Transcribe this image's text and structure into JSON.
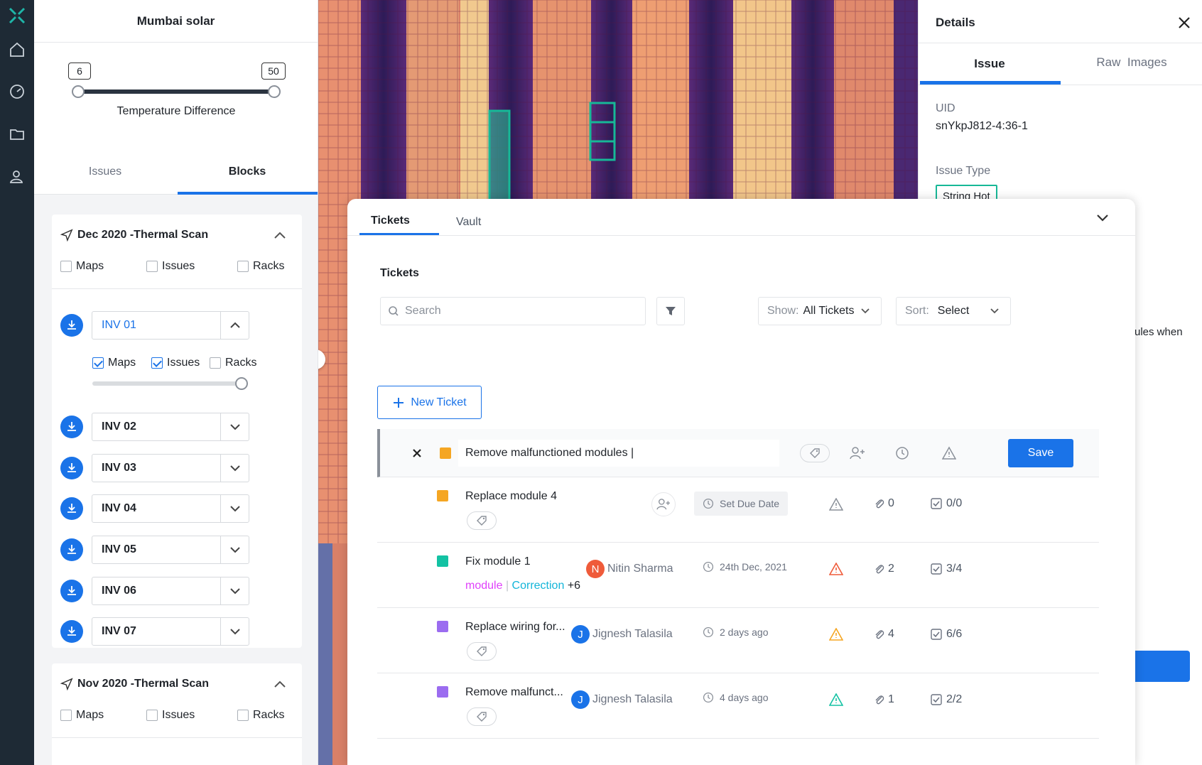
{
  "sidebar": {
    "title": "Mumbai solar",
    "slider": {
      "min_label": "6",
      "max_label": "50",
      "label": "Temperature Difference"
    },
    "tabs": [
      {
        "label": "Issues"
      },
      {
        "label": "Blocks"
      }
    ],
    "scans": [
      {
        "title": "Dec 2020 -Thermal Scan",
        "options": [
          "Maps",
          "Issues",
          "Racks"
        ]
      },
      {
        "title": "Nov 2020 -Thermal Scan",
        "options": [
          "Maps",
          "Issues",
          "Racks"
        ]
      }
    ],
    "inverters": [
      {
        "label": "INV 01",
        "expanded": true
      },
      {
        "label": "INV 02"
      },
      {
        "label": "INV 03"
      },
      {
        "label": "INV 04"
      },
      {
        "label": "INV 05"
      },
      {
        "label": "INV 06"
      },
      {
        "label": "INV 07"
      }
    ],
    "inv01_options": {
      "maps": "Maps",
      "issues": "Issues",
      "racks": "Racks",
      "maps_checked": true,
      "issues_checked": true,
      "racks_checked": false
    }
  },
  "details": {
    "title": "Details",
    "tabs": [
      {
        "label": "Issue"
      },
      {
        "label": "Raw  Images"
      }
    ],
    "uid_label": "UID",
    "uid_value": "snYkpJ812-4:36-1",
    "issue_type_label": "Issue Type",
    "issue_type_value": "String Hot",
    "partial_text": "ules when"
  },
  "tickets_panel": {
    "tabs": [
      {
        "label": "Tickets"
      },
      {
        "label": "Vault"
      }
    ],
    "heading": "Tickets",
    "search_placeholder": "Search",
    "show_label": "Show:",
    "show_value": "All Tickets",
    "sort_label": "Sort:",
    "sort_value": "Select",
    "new_ticket_label": "New Ticket",
    "editing": {
      "value": "Remove malfunctioned modules |",
      "save_label": "Save",
      "color": "#f5a623"
    },
    "tickets": [
      {
        "title": "Replace module 4",
        "color": "#f5a623",
        "assignee": "",
        "due": "Set Due Date",
        "attachments": "0",
        "checklist": "0/0",
        "priority_color": "#8a9099"
      },
      {
        "title": "Fix module 1",
        "color": "#13c2a3",
        "assignee": "Nitin Sharma",
        "avatar": "N",
        "avatar_color": "#ef5b3a",
        "due": "24th Dec, 2021",
        "attachments": "2",
        "checklist": "3/4",
        "priority_color": "#ef5b3a",
        "tags": [
          "module",
          "Correction"
        ],
        "more_tags": "+6"
      },
      {
        "title": "Replace wiring for...",
        "color": "#9b6cf0",
        "assignee": "Jignesh Talasila",
        "avatar": "J",
        "avatar_color": "#1a73e8",
        "due": "2 days ago",
        "attachments": "4",
        "checklist": "6/6",
        "priority_color": "#f5a623"
      },
      {
        "title": "Remove malfunct...",
        "color": "#9b6cf0",
        "assignee": "Jignesh Talasila",
        "avatar": "J",
        "avatar_color": "#1a73e8",
        "due": "4 days ago",
        "attachments": "1",
        "checklist": "2/2",
        "priority_color": "#13c2a3"
      }
    ]
  },
  "colors": {
    "accent": "#1a73e8",
    "rail": "#1e2a35",
    "tag_pink": "#e040fb",
    "tag_cyan": "#13b5d9"
  }
}
